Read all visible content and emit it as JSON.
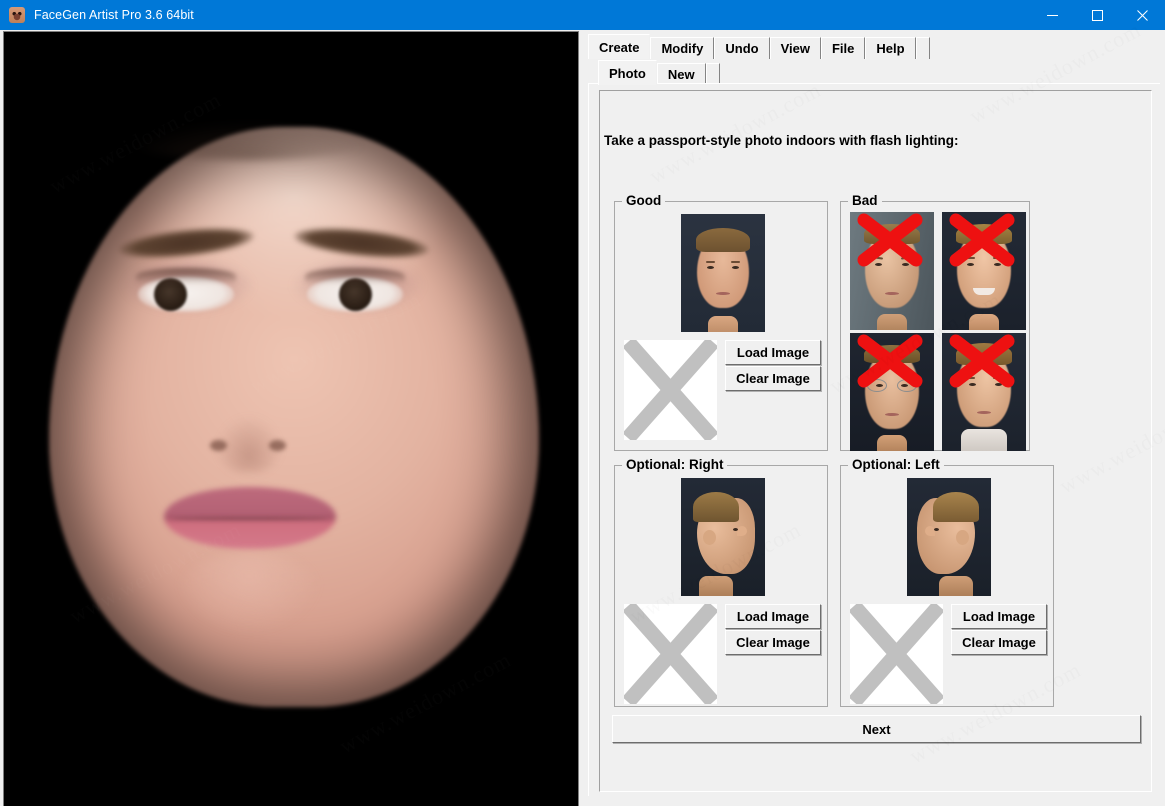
{
  "window": {
    "title": "FaceGen Artist Pro 3.6 64bit",
    "icon": "face-icon",
    "titlebar_color": "#0078d7",
    "controls": {
      "minimize": "minimize-icon",
      "maximize": "maximize-icon",
      "close": "close-icon"
    }
  },
  "tabs": {
    "main": [
      {
        "label": "Create",
        "active": true
      },
      {
        "label": "Modify",
        "active": false
      },
      {
        "label": "Undo",
        "active": false
      },
      {
        "label": "View",
        "active": false
      },
      {
        "label": "File",
        "active": false
      },
      {
        "label": "Help",
        "active": false
      }
    ],
    "sub": [
      {
        "label": "Photo",
        "active": true
      },
      {
        "label": "New",
        "active": false
      }
    ]
  },
  "main": {
    "instruction": "Take a passport-style photo indoors with flash lighting:",
    "groups": [
      {
        "key": "good",
        "title": "Good",
        "example_count": 1,
        "has_placeholder": true,
        "placeholder_icon": "x-placeholder-icon",
        "buttons": {
          "load": "Load Image",
          "clear": "Clear Image"
        }
      },
      {
        "key": "bad",
        "title": "Bad",
        "example_count": 4,
        "has_placeholder": false,
        "marker_icon": "red-x-icon",
        "marker_color": "#ee1111"
      },
      {
        "key": "right",
        "title": "Optional: Right",
        "example_count": 1,
        "has_placeholder": true,
        "placeholder_icon": "x-placeholder-icon",
        "buttons": {
          "load": "Load Image",
          "clear": "Clear Image"
        }
      },
      {
        "key": "left",
        "title": "Optional: Left",
        "example_count": 1,
        "has_placeholder": true,
        "placeholder_icon": "x-placeholder-icon",
        "buttons": {
          "load": "Load Image",
          "clear": "Clear Image"
        }
      }
    ],
    "next_button": "Next"
  },
  "viewport": {
    "background": "#000000",
    "render": "3d-face-model"
  },
  "watermark": {
    "text": "www.weidown.com"
  },
  "colors": {
    "panel": "#f0f0f0",
    "accent": "#0078d7",
    "placeholder_x": "#c0c0c0",
    "bad_marker": "#ee1111"
  }
}
